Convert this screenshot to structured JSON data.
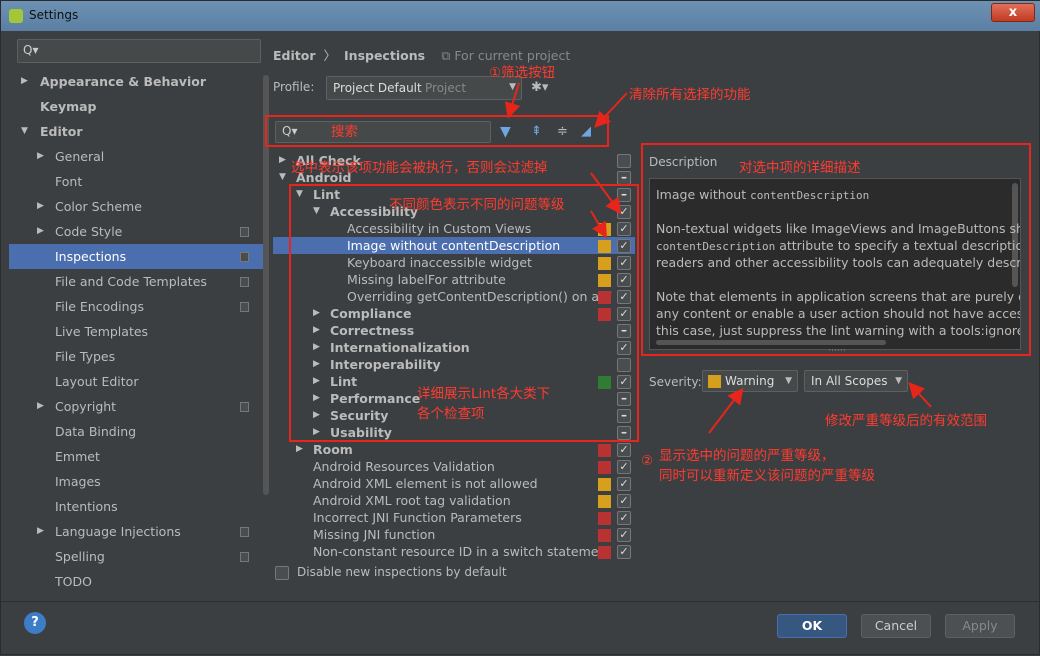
{
  "title": "Settings",
  "close": "x",
  "search_icon": "Q▾",
  "sidebar": [
    {
      "label": "Appearance & Behavior",
      "bold": true,
      "arrow": "right",
      "indent": 0
    },
    {
      "label": "Keymap",
      "bold": true,
      "arrow": "",
      "indent": 0
    },
    {
      "label": "Editor",
      "bold": true,
      "arrow": "down",
      "indent": 0
    },
    {
      "label": "General",
      "arrow": "right",
      "indent": 1
    },
    {
      "label": "Font",
      "arrow": "",
      "indent": 1
    },
    {
      "label": "Color Scheme",
      "arrow": "right",
      "indent": 1
    },
    {
      "label": "Code Style",
      "arrow": "right",
      "indent": 1,
      "copy": true
    },
    {
      "label": "Inspections",
      "arrow": "",
      "indent": 1,
      "copy": true,
      "selected": true
    },
    {
      "label": "File and Code Templates",
      "arrow": "",
      "indent": 1,
      "copy": true
    },
    {
      "label": "File Encodings",
      "arrow": "",
      "indent": 1,
      "copy": true
    },
    {
      "label": "Live Templates",
      "arrow": "",
      "indent": 1
    },
    {
      "label": "File Types",
      "arrow": "",
      "indent": 1
    },
    {
      "label": "Layout Editor",
      "arrow": "",
      "indent": 1
    },
    {
      "label": "Copyright",
      "arrow": "right",
      "indent": 1,
      "copy": true
    },
    {
      "label": "Data Binding",
      "arrow": "",
      "indent": 1
    },
    {
      "label": "Emmet",
      "arrow": "",
      "indent": 1
    },
    {
      "label": "Images",
      "arrow": "",
      "indent": 1
    },
    {
      "label": "Intentions",
      "arrow": "",
      "indent": 1
    },
    {
      "label": "Language Injections",
      "arrow": "right",
      "indent": 1,
      "copy": true
    },
    {
      "label": "Spelling",
      "arrow": "",
      "indent": 1,
      "copy": true
    },
    {
      "label": "TODO",
      "arrow": "",
      "indent": 1
    }
  ],
  "breadcrumb": {
    "first": "Editor",
    "sep": "〉",
    "second": "Inspections",
    "for_project": "For current project",
    "fp_icon": "⧉"
  },
  "profile": {
    "label": "Profile:",
    "value": "Project Default",
    "scope": "Project",
    "arrow": "▼",
    "gear": "✱▾"
  },
  "toolbar": {
    "search_icon": "Q▾",
    "filter_icon": "▼",
    "expand_icon": "⇞",
    "collapse_icon": "≑",
    "clear_icon": "◢"
  },
  "inspections": [
    {
      "label": "All Check",
      "level": 0,
      "arrow": "right",
      "bold": true,
      "check": "empty"
    },
    {
      "label": "Android",
      "level": 0,
      "arrow": "down",
      "bold": true,
      "check": "mixed"
    },
    {
      "label": "Lint",
      "level": 1,
      "arrow": "down",
      "bold": true,
      "check": "mixed"
    },
    {
      "label": "Accessibility",
      "level": 2,
      "arrow": "down",
      "bold": true,
      "check": "checked"
    },
    {
      "label": "Accessibility in Custom Views",
      "level": 3,
      "sev": "#d6a01c",
      "check": "checked"
    },
    {
      "label": "Image without contentDescription",
      "level": 3,
      "sev": "#d6a01c",
      "check": "checked",
      "selected": true
    },
    {
      "label": "Keyboard inaccessible widget",
      "level": 3,
      "sev": "#d6a01c",
      "check": "checked"
    },
    {
      "label": "Missing labelFor attribute",
      "level": 3,
      "sev": "#d6a01c",
      "check": "checked"
    },
    {
      "label": "Overriding getContentDescription() on a V",
      "level": 3,
      "sev": "#b83232",
      "check": "checked"
    },
    {
      "label": "Compliance",
      "level": 2,
      "arrow": "right",
      "bold": true,
      "sev": "#b83232",
      "check": "checked"
    },
    {
      "label": "Correctness",
      "level": 2,
      "arrow": "right",
      "bold": true,
      "check": "mixed"
    },
    {
      "label": "Internationalization",
      "level": 2,
      "arrow": "right",
      "bold": true,
      "check": "checked"
    },
    {
      "label": "Interoperability",
      "level": 2,
      "arrow": "right",
      "bold": true,
      "check": "empty"
    },
    {
      "label": "Lint",
      "level": 2,
      "arrow": "right",
      "bold": true,
      "sev": "#2e7d32",
      "check": "checked"
    },
    {
      "label": "Performance",
      "level": 2,
      "arrow": "right",
      "bold": true,
      "check": "mixed"
    },
    {
      "label": "Security",
      "level": 2,
      "arrow": "right",
      "bold": true,
      "check": "mixed"
    },
    {
      "label": "Usability",
      "level": 2,
      "arrow": "right",
      "bold": true,
      "check": "mixed"
    },
    {
      "label": "Room",
      "level": 1,
      "arrow": "right",
      "bold": true,
      "sev": "#b83232",
      "check": "checked"
    },
    {
      "label": "Android Resources Validation",
      "level": 1,
      "sev": "#b83232",
      "check": "checked"
    },
    {
      "label": "Android XML element is not allowed",
      "level": 1,
      "sev": "#d6a01c",
      "check": "checked"
    },
    {
      "label": "Android XML root tag validation",
      "level": 1,
      "sev": "#d6a01c",
      "check": "checked"
    },
    {
      "label": "Incorrect JNI Function Parameters",
      "level": 1,
      "sev": "#b83232",
      "check": "checked"
    },
    {
      "label": "Missing JNI function",
      "level": 1,
      "sev": "#b83232",
      "check": "checked"
    },
    {
      "label": "Non-constant resource ID in a switch statement",
      "level": 1,
      "sev": "#b83232",
      "check": "checked"
    }
  ],
  "description": {
    "label": "Description",
    "lines": [
      {
        "text": "Image without ",
        "mono": "contentDescription",
        "rest": ""
      },
      {
        "text": "",
        "mono": "",
        "rest": ""
      },
      {
        "text": "Non-textual widgets like ImageViews and ImageButtons should",
        "mono": "",
        "rest": ""
      },
      {
        "text": "",
        "mono": "contentDescription",
        "rest": " attribute to specify a textual description of t"
      },
      {
        "text": "readers and other accessibility tools can adequately describe t",
        "mono": "",
        "rest": ""
      },
      {
        "text": "",
        "mono": "",
        "rest": ""
      },
      {
        "text": "Note that elements in application screens that are purely decor",
        "mono": "",
        "rest": ""
      },
      {
        "text": "any content or enable a user action should not have accessibili",
        "mono": "",
        "rest": ""
      },
      {
        "text": "this case, just suppress the lint warning with a tools:ignore=\"Co",
        "mono": "",
        "rest": ""
      }
    ],
    "resize_grip": "⋯⋯"
  },
  "severity": {
    "label": "Severity:",
    "value": "Warning",
    "scope": "In All Scopes",
    "arrow": "▼"
  },
  "disable_label": "Disable new inspections by default",
  "buttons": {
    "help": "?",
    "ok": "OK",
    "cancel": "Cancel",
    "apply": "Apply"
  },
  "annotations": {
    "filter": "①筛选按钮",
    "clear": "清除所有选择的功能",
    "search": "搜索",
    "detail": "对选中项的详细描述",
    "checked": "选中表示该项功能会被执行，否则会过滤掉",
    "colors": "不同颜色表示不同的问题等级",
    "lint1": "详细展示Lint各大类下",
    "lint2": "各个检查项",
    "sev_num": "②",
    "sev1": "显示选中的问题的严重等级，",
    "sev2": "同时可以重新定义该问题的严重等级",
    "scope": "修改严重等级后的有效范围"
  }
}
